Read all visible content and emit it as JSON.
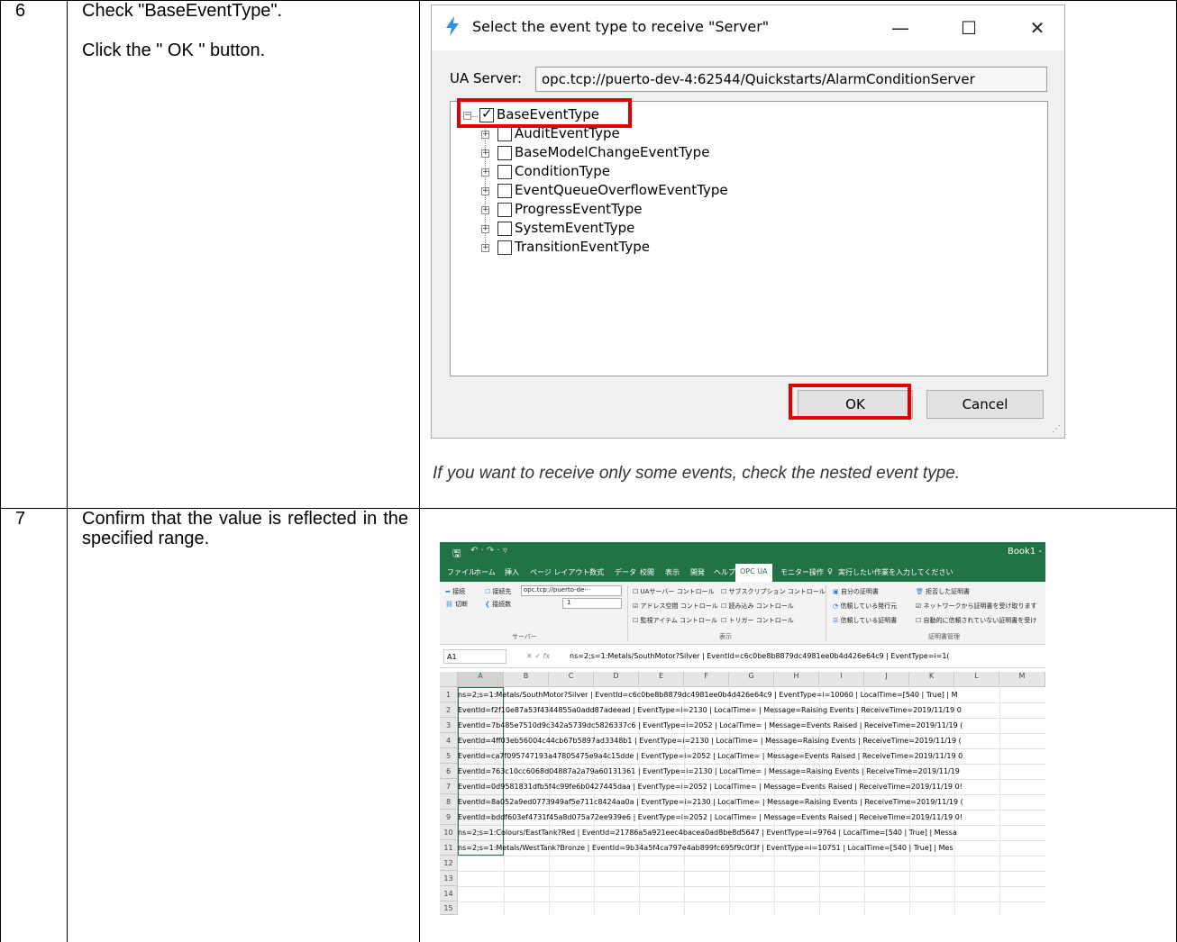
{
  "rows": [
    {
      "num": "6",
      "instructions": [
        "Check \"BaseEventType\".",
        "Click the \" OK \" button."
      ],
      "note": "If you want to receive only some events, check the nested event type."
    },
    {
      "num": "7",
      "instructions": [
        "Confirm that the value is reflected in the specified range."
      ]
    }
  ],
  "dialog": {
    "title": "Select the event type to receive \"Server\"",
    "server_label": "UA Server:",
    "server_value": "opc.tcp://puerto-dev-4:62544/Quickstarts/AlarmConditionServer",
    "root": {
      "label": "BaseEventType",
      "checked": true
    },
    "children": [
      "AuditEventType",
      "BaseModelChangeEventType",
      "ConditionType",
      "EventQueueOverflowEventType",
      "ProgressEventType",
      "SystemEventType",
      "TransitionEventType"
    ],
    "ok_label": "OK",
    "cancel_label": "Cancel",
    "minimize": "—",
    "maximize": "☐",
    "close": "✕"
  },
  "excel": {
    "book": "Book1 -",
    "tabs": [
      "ファイル",
      "ホーム",
      "挿入",
      "ページ レイアウト",
      "数式",
      "データ",
      "校閲",
      "表示",
      "開発",
      "ヘルプ",
      "OPC UA",
      "モニター操作",
      "実行したい作業を入力してください"
    ],
    "active_tab": "OPC UA",
    "ribbon": {
      "connect": "接続",
      "disconnect": "切断",
      "target_label": "接続先",
      "target_value": "opc.tcp://puerto-de···",
      "count_label": "接続数",
      "count_value": "1",
      "server_group": "サーバー",
      "opts": [
        "UAサーバー コントロール",
        "サブスクリプション コントロール",
        "アドレス空間 コントロール",
        "読み込み コントロール",
        "監視アイテム コントロール",
        "トリガー コントロール"
      ],
      "display_group": "表示",
      "certs": [
        "自分の証明書",
        "拒否した証明書",
        "信頼している発行元",
        "ネットワークから証明書を受け取ります",
        "信頼している証明書",
        "自動的に信頼されていない証明書を受け"
      ],
      "cert_group": "証明書管理"
    },
    "namebox": "A1",
    "formula": "ns=2;s=1:Metals/SouthMotor?Silver | EventId=c6c0be8b8879dc4981ee0b4d426e64c9 | EventType=i=1(",
    "columns": [
      "A",
      "B",
      "C",
      "D",
      "E",
      "F",
      "G",
      "H",
      "I",
      "J",
      "K",
      "L",
      "M"
    ],
    "row_numbers": [
      "1",
      "2",
      "3",
      "4",
      "5",
      "6",
      "7",
      "8",
      "9",
      "10",
      "11",
      "12",
      "13",
      "14",
      "15"
    ],
    "cells": [
      "ns=2;s=1:Metals/SouthMotor?Silver | EventId=c6c0be8b8879dc4981ee0b4d426e64c9 | EventType=i=10060 | LocalTime=[540 | True] | M",
      "EventId=f2f10e87a53f4344855a0add87adeead | EventType=i=2130 | LocalTime= | Message=Raising Events | ReceiveTime=2019/11/19 0",
      "EventId=7b485e7510d9c342a5739dc5826337c6 | EventType=i=2052 | LocalTime= | Message=Events Raised | ReceiveTime=2019/11/19 (",
      "EventId=4ff03eb56004c44cb67b5897ad3348b1 | EventType=i=2130 | LocalTime= | Message=Raising Events | ReceiveTime=2019/11/19 (",
      "EventId=ca7f095747193a47805475e9a4c15dde | EventType=i=2052 | LocalTime= | Message=Events Raised | ReceiveTime=2019/11/19 0",
      "EventId=763c10cc6068d04887a2a79a60131361 | EventType=i=2130 | LocalTime= | Message=Raising Events | ReceiveTime=2019/11/19",
      "EventId=0d9581831dfb5f4c99fe6b0427445daa | EventType=i=2052 | LocalTime= | Message=Events Raised | ReceiveTime=2019/11/19 0!",
      "EventId=8a052a9ed0773949af5e711c8424aa0a | EventType=i=2130 | LocalTime= | Message=Raising Events | ReceiveTime=2019/11/19 (",
      "EventId=bddf603ef4731f45a8d075a72ee939e6 | EventType=i=2052 | LocalTime= | Message=Events Raised | ReceiveTime=2019/11/19 0!",
      "ns=2;s=1:Colours/EastTank?Red | EventId=21786a5a921eec4bacea0ad8be8d5647 | EventType=i=9764 | LocalTime=[540 | True] | Messa",
      "ns=2;s=1:Metals/WestTank?Bronze | EventId=9b34a5f4ca797e4ab899fc695f9c0f3f | EventType=i=10751 | LocalTime=[540 | True] | Mes"
    ]
  },
  "colors": {
    "highlight": "#e00000",
    "excel_green": "#217346",
    "bolt": "#2f8fe6"
  }
}
